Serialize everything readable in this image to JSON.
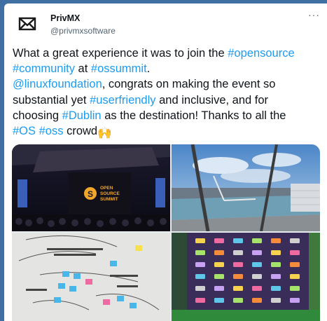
{
  "tweet": {
    "author_name": "PrivMX",
    "handle": "@privmxsoftware",
    "more_icon": "more-icon",
    "lines": [
      [
        {
          "t": "What a great experience it was to join the ",
          "k": "text"
        },
        {
          "t": "#opensource",
          "k": "hashtag"
        }
      ],
      [
        {
          "t": "#community",
          "k": "hashtag"
        },
        {
          "t": " at ",
          "k": "text"
        },
        {
          "t": "#ossummit",
          "k": "hashtag"
        },
        {
          "t": ".",
          "k": "text"
        }
      ],
      [
        {
          "t": " @linuxfoundation",
          "k": "mention"
        },
        {
          "t": ", congrats on making the event so",
          "k": "text"
        }
      ],
      [
        {
          "t": "substantial yet ",
          "k": "text"
        },
        {
          "t": "#userfriendly",
          "k": "hashtag"
        },
        {
          "t": " and inclusive, and for",
          "k": "text"
        }
      ],
      [
        {
          "t": "choosing ",
          "k": "text"
        },
        {
          "t": "#Dublin",
          "k": "hashtag"
        },
        {
          "t": " as the destination! Thanks to all the",
          "k": "text"
        }
      ],
      [
        {
          "t": "#OS",
          "k": "hashtag"
        },
        {
          "t": " ",
          "k": "text"
        },
        {
          "t": "#oss",
          "k": "hashtag"
        },
        {
          "t": " crowd",
          "k": "text"
        }
      ]
    ],
    "trailing_emoji": "🙌",
    "link_color": "#1d9bf0"
  },
  "media": {
    "stage_logo_text": [
      "OPEN",
      "SOURCE",
      "SUMMIT"
    ],
    "stage_logo_letter": "S",
    "photos": [
      {
        "name": "photo-stage"
      },
      {
        "name": "photo-dublin-view"
      },
      {
        "name": "photo-sticky-board"
      },
      {
        "name": "photo-sticker-wall"
      }
    ]
  }
}
